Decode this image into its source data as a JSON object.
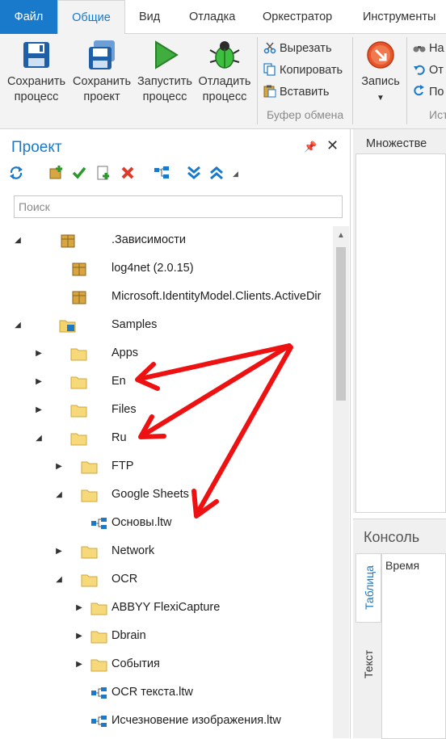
{
  "menu": {
    "tabs": [
      "Файл",
      "Общие",
      "Вид",
      "Отладка",
      "Оркестратор",
      "Инструменты"
    ],
    "active_index": 1
  },
  "ribbon": {
    "save_process": [
      "Сохранить",
      "процесс"
    ],
    "save_project": [
      "Сохранить",
      "проект"
    ],
    "run_process": [
      "Запустить",
      "процесс"
    ],
    "debug_process": [
      "Отладить",
      "процесс"
    ],
    "cut": "Вырезать",
    "copy": "Копировать",
    "paste": "Вставить",
    "clipboard_group": "Буфер обмена",
    "record": "Запись",
    "right_items": [
      "На",
      "От",
      "По"
    ],
    "right_group": "Ист"
  },
  "project_panel": {
    "title": "Проект",
    "search_placeholder": "Поиск",
    "tree": [
      {
        "label": ".Зависимости",
        "depth": 0,
        "arrow": "expanded",
        "icon": "package-icon"
      },
      {
        "label": "log4net (2.0.15)",
        "depth": 1,
        "arrow": "none",
        "icon": "package-icon"
      },
      {
        "label": "Microsoft.IdentityModel.Clients.ActiveDir",
        "depth": 1,
        "arrow": "none",
        "icon": "package-icon"
      },
      {
        "label": "Samples",
        "depth": 0,
        "arrow": "expanded",
        "icon": "project-folder-icon"
      },
      {
        "label": "Apps",
        "depth": 1,
        "arrow": "collapsed",
        "icon": "folder-icon"
      },
      {
        "label": "En",
        "depth": 1,
        "arrow": "collapsed",
        "icon": "folder-icon"
      },
      {
        "label": "Files",
        "depth": 1,
        "arrow": "collapsed",
        "icon": "folder-icon"
      },
      {
        "label": "Ru",
        "depth": 1,
        "arrow": "expanded",
        "icon": "folder-icon"
      },
      {
        "label": "FTP",
        "depth": 2,
        "arrow": "collapsed",
        "icon": "folder-icon"
      },
      {
        "label": "Google Sheets",
        "depth": 2,
        "arrow": "expanded",
        "icon": "folder-icon"
      },
      {
        "label": "Основы.ltw",
        "depth": 3,
        "arrow": "none",
        "icon": "workflow-icon"
      },
      {
        "label": "Network",
        "depth": 2,
        "arrow": "collapsed",
        "icon": "folder-icon"
      },
      {
        "label": "OCR",
        "depth": 2,
        "arrow": "expanded",
        "icon": "folder-icon"
      },
      {
        "label": "ABBYY FlexiCapture",
        "depth": 3,
        "arrow": "collapsed",
        "icon": "folder-icon"
      },
      {
        "label": "Dbrain",
        "depth": 3,
        "arrow": "collapsed",
        "icon": "folder-icon"
      },
      {
        "label": "События",
        "depth": 3,
        "arrow": "collapsed",
        "icon": "folder-icon"
      },
      {
        "label": "OCR текста.ltw",
        "depth": 3,
        "arrow": "none",
        "icon": "workflow-icon"
      },
      {
        "label": "Исчезновение изображения.ltw",
        "depth": 3,
        "arrow": "none",
        "icon": "workflow-icon"
      }
    ]
  },
  "document_tab": "Множестве",
  "console": {
    "title": "Консоль",
    "tabs": [
      "Таблица",
      "Текст"
    ],
    "column_header": "Время"
  },
  "colors": {
    "accent": "#1979ca",
    "annotation_arrow": "#ee1111"
  }
}
